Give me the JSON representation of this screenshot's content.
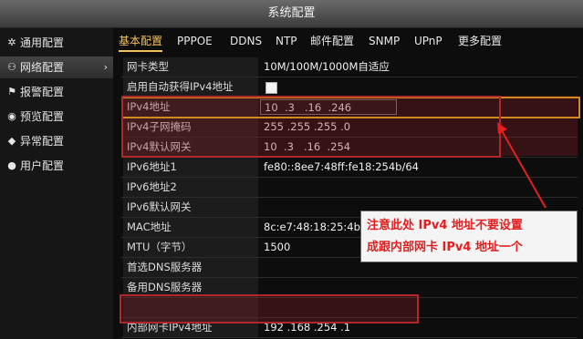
{
  "window": {
    "title": "系统配置"
  },
  "sidebar": {
    "items": [
      {
        "label": "通用配置",
        "icon": "gear-icon"
      },
      {
        "label": "网络配置",
        "icon": "network-icon",
        "active": true
      },
      {
        "label": "报警配置",
        "icon": "alarm-icon"
      },
      {
        "label": "预览配置",
        "icon": "eye-icon"
      },
      {
        "label": "异常配置",
        "icon": "exception-icon"
      },
      {
        "label": "用户配置",
        "icon": "user-icon"
      }
    ]
  },
  "tabs": [
    "基本配置",
    "PPPOE",
    "DDNS",
    "NTP",
    "邮件配置",
    "SNMP",
    "UPnP",
    "更多配置"
  ],
  "rows": [
    {
      "label": "网卡类型",
      "value": "10M/100M/1000M自适应"
    },
    {
      "label": "启用自动获得IPv4地址",
      "value": ""
    },
    {
      "label": "IPv4地址",
      "value": "10  .3   .16  .246"
    },
    {
      "label": "IPv4子网掩码",
      "value": "255 .255 .255 .0"
    },
    {
      "label": "IPv4默认网关",
      "value": "10  .3   .16  .254"
    },
    {
      "label": "IPv6地址1",
      "value": "fe80::8ee7:48ff:fe18:254b/64"
    },
    {
      "label": "IPv6地址2",
      "value": ""
    },
    {
      "label": "IPv6默认网关",
      "value": ""
    },
    {
      "label": "MAC地址",
      "value": "8c:e7:48:18:25:4b"
    },
    {
      "label": "MTU（字节）",
      "value": "1500"
    },
    {
      "label": "首选DNS服务器",
      "value": ""
    },
    {
      "label": "备用DNS服务器",
      "value": ""
    },
    {
      "label": "",
      "value": ""
    },
    {
      "label": "内部网卡IPv4地址",
      "value": "192 .168 .254 .1"
    }
  ],
  "annotation": {
    "line1": "注意此处 IPv4 地址不要设置",
    "line2": "成跟内部网卡 IPv4 地址一个",
    "color": "#e41e1e"
  }
}
